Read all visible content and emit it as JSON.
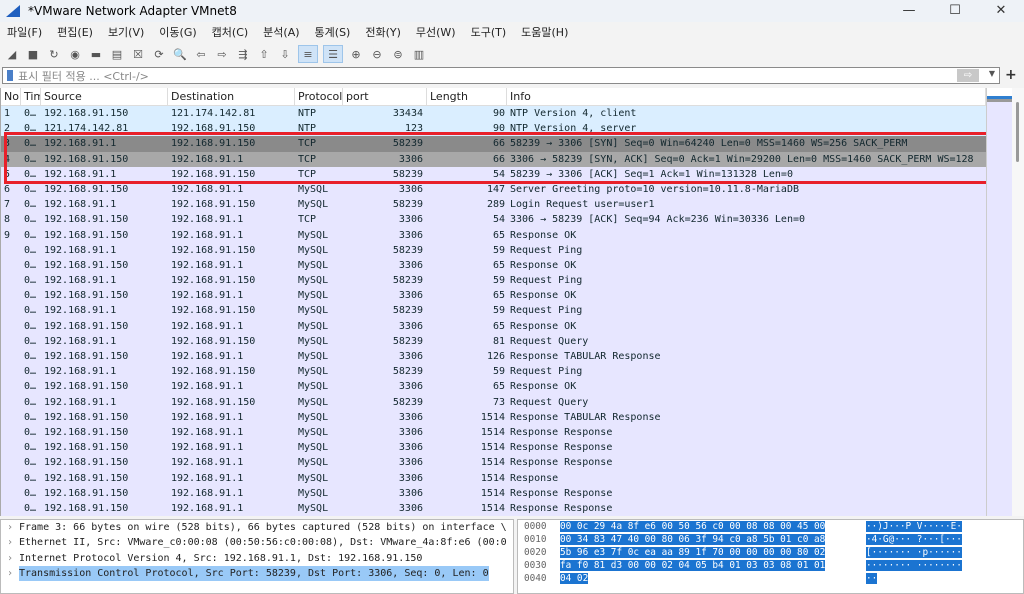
{
  "window": {
    "title": "*VMware Network Adapter VMnet8",
    "minimize": "—",
    "maximize": "☐",
    "close": "✕"
  },
  "menu": [
    "파일(F)",
    "편집(E)",
    "보기(V)",
    "이동(G)",
    "캡처(C)",
    "분석(A)",
    "통계(S)",
    "전화(Y)",
    "무선(W)",
    "도구(T)",
    "도움말(H)"
  ],
  "toolbar": [
    {
      "icon": "shark-fin-icon",
      "g": "◢"
    },
    {
      "icon": "stop-icon",
      "g": "■"
    },
    {
      "icon": "restart-icon",
      "g": "↻"
    },
    {
      "icon": "options-icon",
      "g": "◉"
    },
    {
      "icon": "open-folder-icon",
      "g": "▬"
    },
    {
      "icon": "save-icon",
      "g": "▤"
    },
    {
      "icon": "close-file-icon",
      "g": "☒"
    },
    {
      "icon": "reload-icon",
      "g": "⟳"
    },
    {
      "icon": "find-icon",
      "g": "🔍"
    },
    {
      "icon": "back-icon",
      "g": "⇦"
    },
    {
      "icon": "forward-icon",
      "g": "⇨"
    },
    {
      "icon": "goto-icon",
      "g": "⇶"
    },
    {
      "icon": "first-packet-icon",
      "g": "⇧"
    },
    {
      "icon": "last-packet-icon",
      "g": "⇩"
    },
    {
      "icon": "autoscroll-icon",
      "g": "≡"
    },
    {
      "icon": "colorize-icon",
      "g": "☰"
    },
    {
      "icon": "zoom-in-icon",
      "g": "⊕"
    },
    {
      "icon": "zoom-out-icon",
      "g": "⊖"
    },
    {
      "icon": "zoom-reset-icon",
      "g": "⊜"
    },
    {
      "icon": "resize-columns-icon",
      "g": "▥"
    }
  ],
  "filter": {
    "placeholder": "표시 필터 적용 ... <Ctrl-/>",
    "apply": "⇨",
    "plus": "+"
  },
  "columns": [
    "No",
    "Tim",
    "Source",
    "Destination",
    "Protocol",
    "port",
    "Length",
    "Info"
  ],
  "packets": [
    [
      "1",
      "0…",
      "192.168.91.150",
      "121.174.142.81",
      "NTP",
      "33434",
      "90",
      "NTP Version 4, client",
      "ntp"
    ],
    [
      "2",
      "0…",
      "121.174.142.81",
      "192.168.91.150",
      "NTP",
      "123",
      "90",
      "NTP Version 4, server",
      "ntp"
    ],
    [
      "3",
      "0…",
      "192.168.91.1",
      "192.168.91.150",
      "TCP",
      "58239",
      "66",
      "58239 → 3306 [SYN] Seq=0 Win=64240 Len=0 MSS=1460 WS=256 SACK_PERM",
      "sel"
    ],
    [
      "4",
      "0…",
      "192.168.91.150",
      "192.168.91.1",
      "TCP",
      "3306",
      "66",
      "3306 → 58239 [SYN, ACK] Seq=0 Ack=1 Win=29200 Len=0 MSS=1460 SACK_PERM WS=128",
      "sel2"
    ],
    [
      "5",
      "0…",
      "192.168.91.1",
      "192.168.91.150",
      "TCP",
      "58239",
      "54",
      "58239 → 3306 [ACK] Seq=1 Ack=1 Win=131328 Len=0",
      "sql"
    ],
    [
      "6",
      "0…",
      "192.168.91.150",
      "192.168.91.1",
      "MySQL",
      "3306",
      "147",
      "Server Greeting  proto=10 version=10.11.8-MariaDB",
      "sql"
    ],
    [
      "7",
      "0…",
      "192.168.91.1",
      "192.168.91.150",
      "MySQL",
      "58239",
      "289",
      "Login Request user=user1",
      "sql"
    ],
    [
      "8",
      "0…",
      "192.168.91.150",
      "192.168.91.1",
      "TCP",
      "3306",
      "54",
      "3306 → 58239 [ACK] Seq=94 Ack=236 Win=30336 Len=0",
      "sql"
    ],
    [
      "9",
      "0…",
      "192.168.91.150",
      "192.168.91.1",
      "MySQL",
      "3306",
      "65",
      "Response  OK",
      "sql"
    ],
    [
      "",
      "0…",
      "192.168.91.1",
      "192.168.91.150",
      "MySQL",
      "58239",
      "59",
      "Request Ping",
      "sql"
    ],
    [
      "",
      "0…",
      "192.168.91.150",
      "192.168.91.1",
      "MySQL",
      "3306",
      "65",
      "Response  OK",
      "sql"
    ],
    [
      "",
      "0…",
      "192.168.91.1",
      "192.168.91.150",
      "MySQL",
      "58239",
      "59",
      "Request Ping",
      "sql"
    ],
    [
      "",
      "0…",
      "192.168.91.150",
      "192.168.91.1",
      "MySQL",
      "3306",
      "65",
      "Response  OK",
      "sql"
    ],
    [
      "",
      "0…",
      "192.168.91.1",
      "192.168.91.150",
      "MySQL",
      "58239",
      "59",
      "Request Ping",
      "sql"
    ],
    [
      "",
      "0…",
      "192.168.91.150",
      "192.168.91.1",
      "MySQL",
      "3306",
      "65",
      "Response  OK",
      "sql"
    ],
    [
      "",
      "0…",
      "192.168.91.1",
      "192.168.91.150",
      "MySQL",
      "58239",
      "81",
      "Request Query",
      "sql"
    ],
    [
      "",
      "0…",
      "192.168.91.150",
      "192.168.91.1",
      "MySQL",
      "3306",
      "126",
      "Response TABULAR Response",
      "sql"
    ],
    [
      "",
      "0…",
      "192.168.91.1",
      "192.168.91.150",
      "MySQL",
      "58239",
      "59",
      "Request Ping",
      "sql"
    ],
    [
      "",
      "0…",
      "192.168.91.150",
      "192.168.91.1",
      "MySQL",
      "3306",
      "65",
      "Response  OK",
      "sql"
    ],
    [
      "",
      "0…",
      "192.168.91.1",
      "192.168.91.150",
      "MySQL",
      "58239",
      "73",
      "Request Query",
      "sql"
    ],
    [
      "",
      "0…",
      "192.168.91.150",
      "192.168.91.1",
      "MySQL",
      "3306",
      "1514",
      "Response TABULAR Response",
      "sql"
    ],
    [
      "",
      "0…",
      "192.168.91.150",
      "192.168.91.1",
      "MySQL",
      "3306",
      "1514",
      "Response Response",
      "sql"
    ],
    [
      "",
      "0…",
      "192.168.91.150",
      "192.168.91.1",
      "MySQL",
      "3306",
      "1514",
      "Response Response",
      "sql"
    ],
    [
      "",
      "0…",
      "192.168.91.150",
      "192.168.91.1",
      "MySQL",
      "3306",
      "1514",
      "Response Response",
      "sql"
    ],
    [
      "",
      "0…",
      "192.168.91.150",
      "192.168.91.1",
      "MySQL",
      "3306",
      "1514",
      "Response",
      "sql"
    ],
    [
      "",
      "0…",
      "192.168.91.150",
      "192.168.91.1",
      "MySQL",
      "3306",
      "1514",
      "Response Response",
      "sql"
    ],
    [
      "",
      "0…",
      "192.168.91.150",
      "192.168.91.1",
      "MySQL",
      "3306",
      "1514",
      "Response Response",
      "sql"
    ]
  ],
  "details": [
    {
      "text": "Frame 3: 66 bytes on wire (528 bits), 66 bytes captured (528 bits) on interface \\",
      "selected": false
    },
    {
      "text": "Ethernet II, Src: VMware_c0:00:08 (00:50:56:c0:00:08), Dst: VMware_4a:8f:e6 (00:0",
      "selected": false
    },
    {
      "text": "Internet Protocol Version 4, Src: 192.168.91.1, Dst: 192.168.91.150",
      "selected": false
    },
    {
      "text": "Transmission Control Protocol, Src Port: 58239, Dst Port: 3306, Seq: 0, Len: 0",
      "selected": true
    }
  ],
  "bytes": [
    [
      "0000",
      "00 0c 29 4a 8f e6 00 50  56 c0 00 08 08 00 45 00",
      "··)J···P V·····E·"
    ],
    [
      "0010",
      "00 34 83 47 40 00 80 06  3f 94 c0 a8 5b 01 c0 a8",
      "·4·G@··· ?···[···"
    ],
    [
      "0020",
      "5b 96 e3 7f 0c ea aa 89  1f 70 00 00 00 00 80 02",
      "[······· ·p······"
    ],
    [
      "0030",
      "fa f0 81 d3 00 00 02 04  05 b4 01 03 03 08 01 01",
      "········ ········"
    ],
    [
      "0040",
      "04 02",
      "··"
    ]
  ],
  "colors": {
    "ntp": "#daeeff",
    "mysql_tcp": "#e7e6ff",
    "selected": "#8a8a8a",
    "highlight_box": "#e8202a",
    "bytes_selected": "#1b74d1"
  }
}
